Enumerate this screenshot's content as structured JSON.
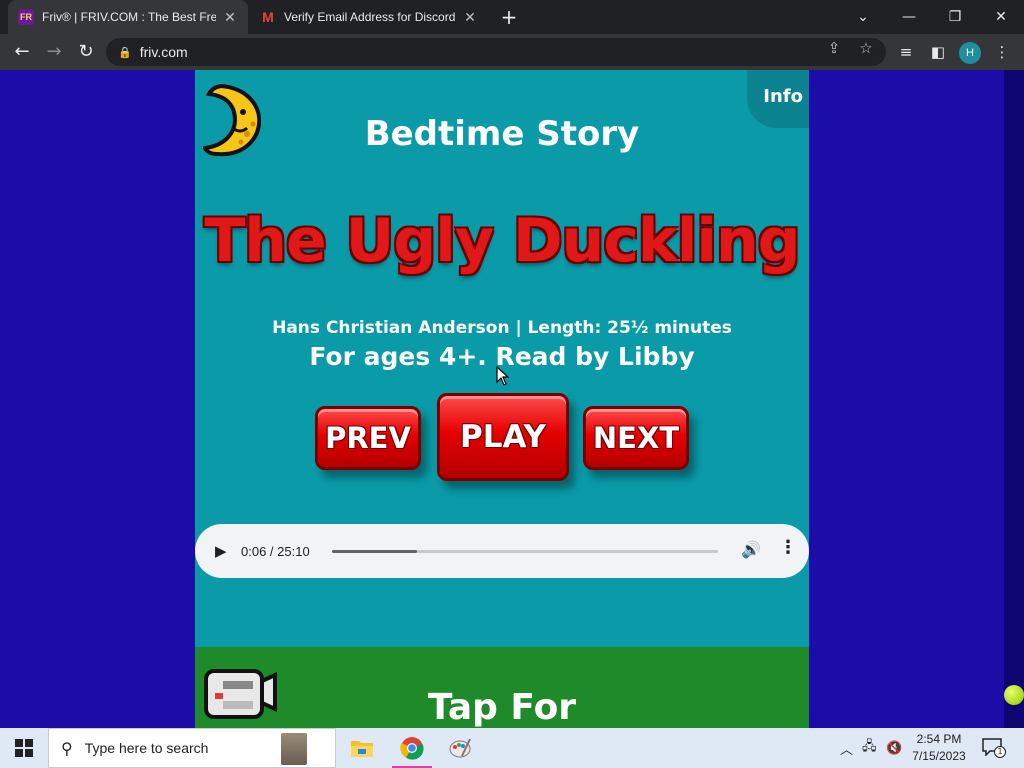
{
  "browser": {
    "tabs": [
      {
        "title": "Friv® | FRIV.COM : The Best Free",
        "favicon": "friv-favicon",
        "active": true
      },
      {
        "title": "Verify Email Address for Discord",
        "favicon": "gmail-favicon",
        "active": false
      }
    ],
    "url": "friv.com",
    "profile_initial": "H"
  },
  "page": {
    "info_label": "Info",
    "heading": "Bedtime Story",
    "story_title": "The Ugly Duckling",
    "meta": "Hans Christian Anderson | Length: 25½ minutes",
    "ages": "For ages 4+. Read by Libby",
    "buttons": {
      "prev": "PREV",
      "play": "PLAY",
      "next": "NEXT"
    },
    "audio": {
      "time": "0:06 / 25:10",
      "progress_fraction": 0.22
    },
    "next_section_heading": "Tap For"
  },
  "taskbar": {
    "search_placeholder": "Type here to search",
    "time": "2:54 PM",
    "date": "7/15/2023",
    "notification_count": "1"
  },
  "colors": {
    "page_bg": "#1c0ca8",
    "story_panel": "#0a9aa8",
    "title_red": "#e01818",
    "green_panel": "#1f8a2a"
  }
}
